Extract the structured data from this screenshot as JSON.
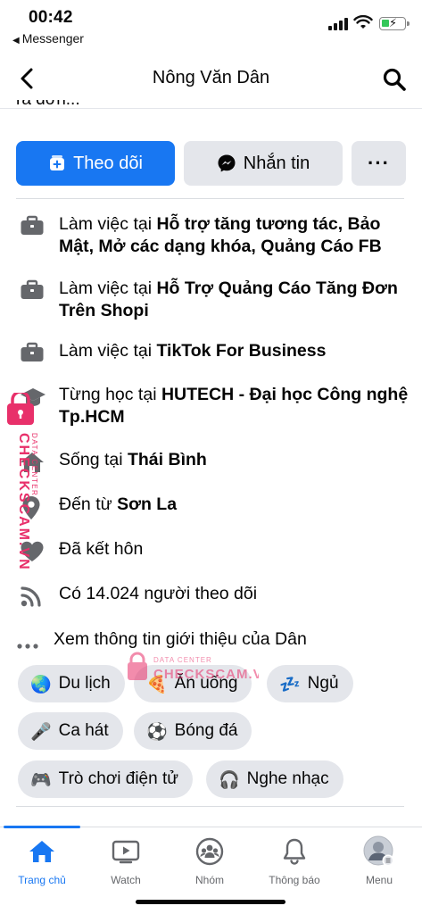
{
  "status": {
    "time": "00:42",
    "back_app": "Messenger"
  },
  "nav": {
    "title": "Nông Văn Dân"
  },
  "cut_text": "ra đơn...",
  "actions": {
    "follow": "Theo dõi",
    "message": "Nhắn tin",
    "more": "···"
  },
  "info": {
    "work1_prefix": "Làm việc tại ",
    "work1_place": "Hỗ trợ tăng tương tác, Bảo Mật, Mở các dạng khóa, Quảng Cáo FB",
    "work2_prefix": "Làm việc tại ",
    "work2_place": "Hỗ Trợ Quảng Cáo Tăng Đơn Trên Shopi",
    "work3_prefix": "Làm việc tại ",
    "work3_place": "TikTok For Business",
    "edu_prefix": "Từng học tại ",
    "edu_place": "HUTECH - Đại học Công nghệ Tp.HCM",
    "live_prefix": "Sống tại ",
    "live_place": "Thái Bình",
    "from_prefix": "Đến từ ",
    "from_place": "Sơn La",
    "relationship": "Đã kết hôn",
    "followers": "Có 14.024 người theo dõi",
    "see_about": "Xem thông tin giới thiệu của Dân"
  },
  "hobbies": [
    {
      "emoji": "🌏",
      "label": "Du lịch"
    },
    {
      "emoji": "🍕",
      "label": "Ăn uống"
    },
    {
      "emoji": "💤",
      "label": "Ngủ"
    },
    {
      "emoji": "🎤",
      "label": "Ca hát"
    },
    {
      "emoji": "⚽",
      "label": "Bóng đá"
    },
    {
      "emoji": "🎮",
      "label": "Trò chơi điện tử"
    },
    {
      "emoji": "🎧",
      "label": "Nghe nhạc"
    }
  ],
  "watermark": {
    "brand": "CHECKSCAM.VN",
    "sub": "DATA CENTER"
  },
  "tabs": [
    {
      "label": "Trang chủ",
      "icon": "home-icon",
      "active": true
    },
    {
      "label": "Watch",
      "icon": "watch-icon"
    },
    {
      "label": "Nhóm",
      "icon": "groups-icon"
    },
    {
      "label": "Thông báo",
      "icon": "bell-icon"
    },
    {
      "label": "Menu",
      "icon": "avatar-menu-icon"
    }
  ],
  "colors": {
    "accent": "#1877f2",
    "chip_bg": "#e4e6eb",
    "icon_gray": "#65676b",
    "watermark": "#e8306a"
  }
}
